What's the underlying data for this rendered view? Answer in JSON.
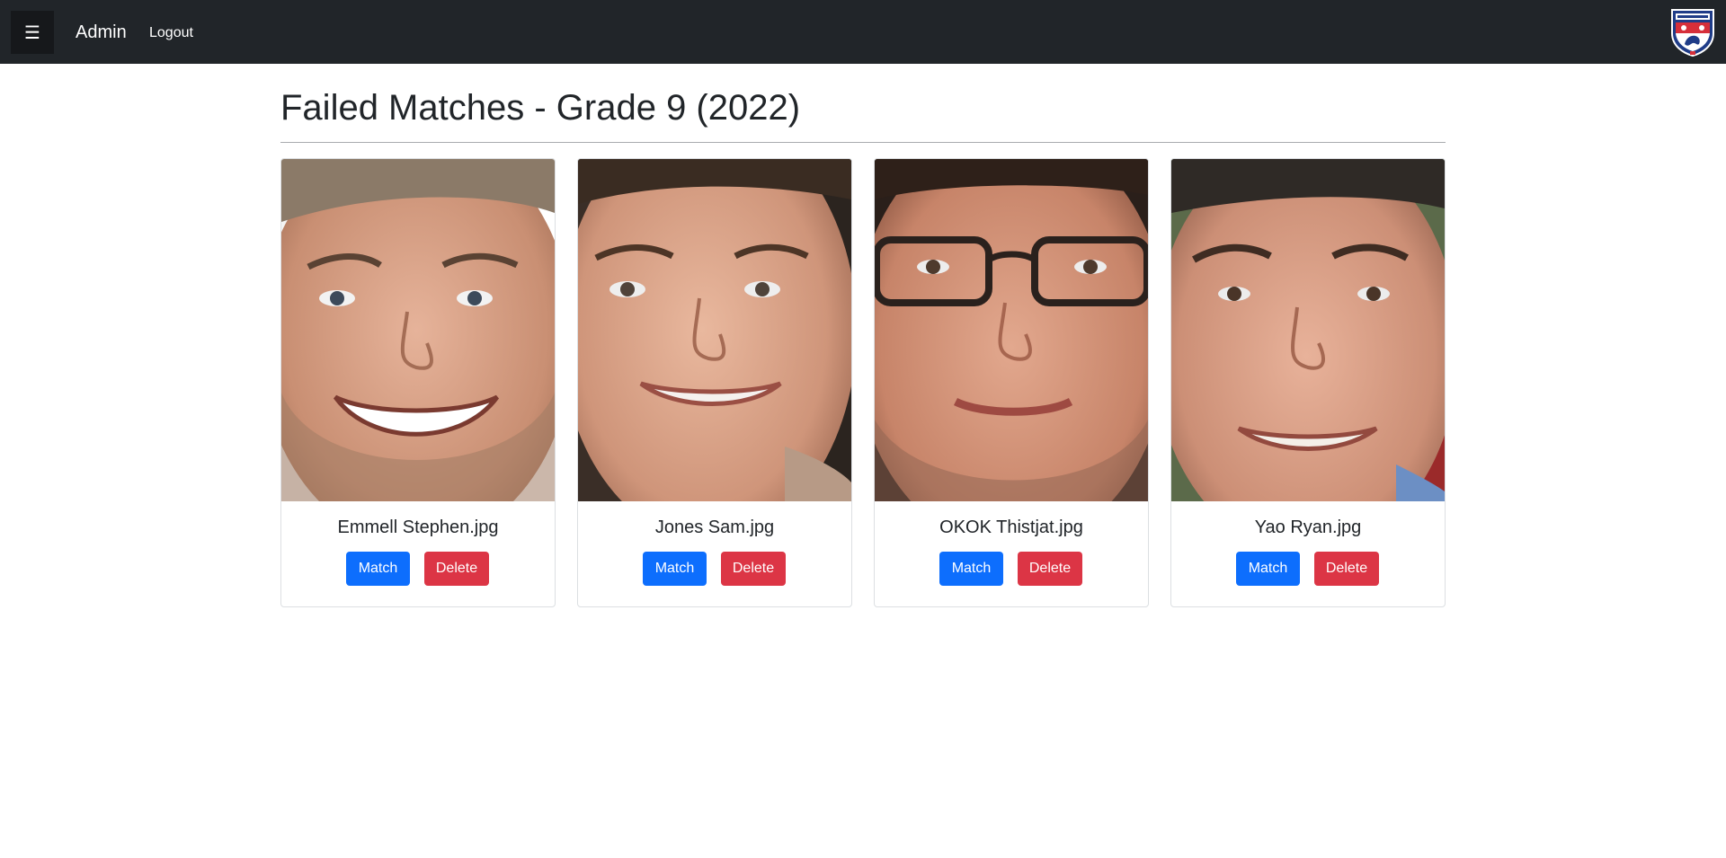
{
  "navbar": {
    "menu_icon": "hamburger-icon",
    "menu_glyph": "☰",
    "brand": "Admin",
    "logout": "Logout",
    "crest_icon": "school-crest-icon"
  },
  "page": {
    "title": "Failed Matches - Grade 9 (2022)"
  },
  "cards": [
    {
      "filename": "Emmell Stephen.jpg",
      "match_label": "Match",
      "delete_label": "Delete"
    },
    {
      "filename": "Jones Sam.jpg",
      "match_label": "Match",
      "delete_label": "Delete"
    },
    {
      "filename": "OKOK Thistjat.jpg",
      "match_label": "Match",
      "delete_label": "Delete"
    },
    {
      "filename": "Yao Ryan.jpg",
      "match_label": "Match",
      "delete_label": "Delete"
    }
  ],
  "colors": {
    "navbar": "#212529",
    "primary": "#0d6efd",
    "danger": "#dc3545"
  }
}
